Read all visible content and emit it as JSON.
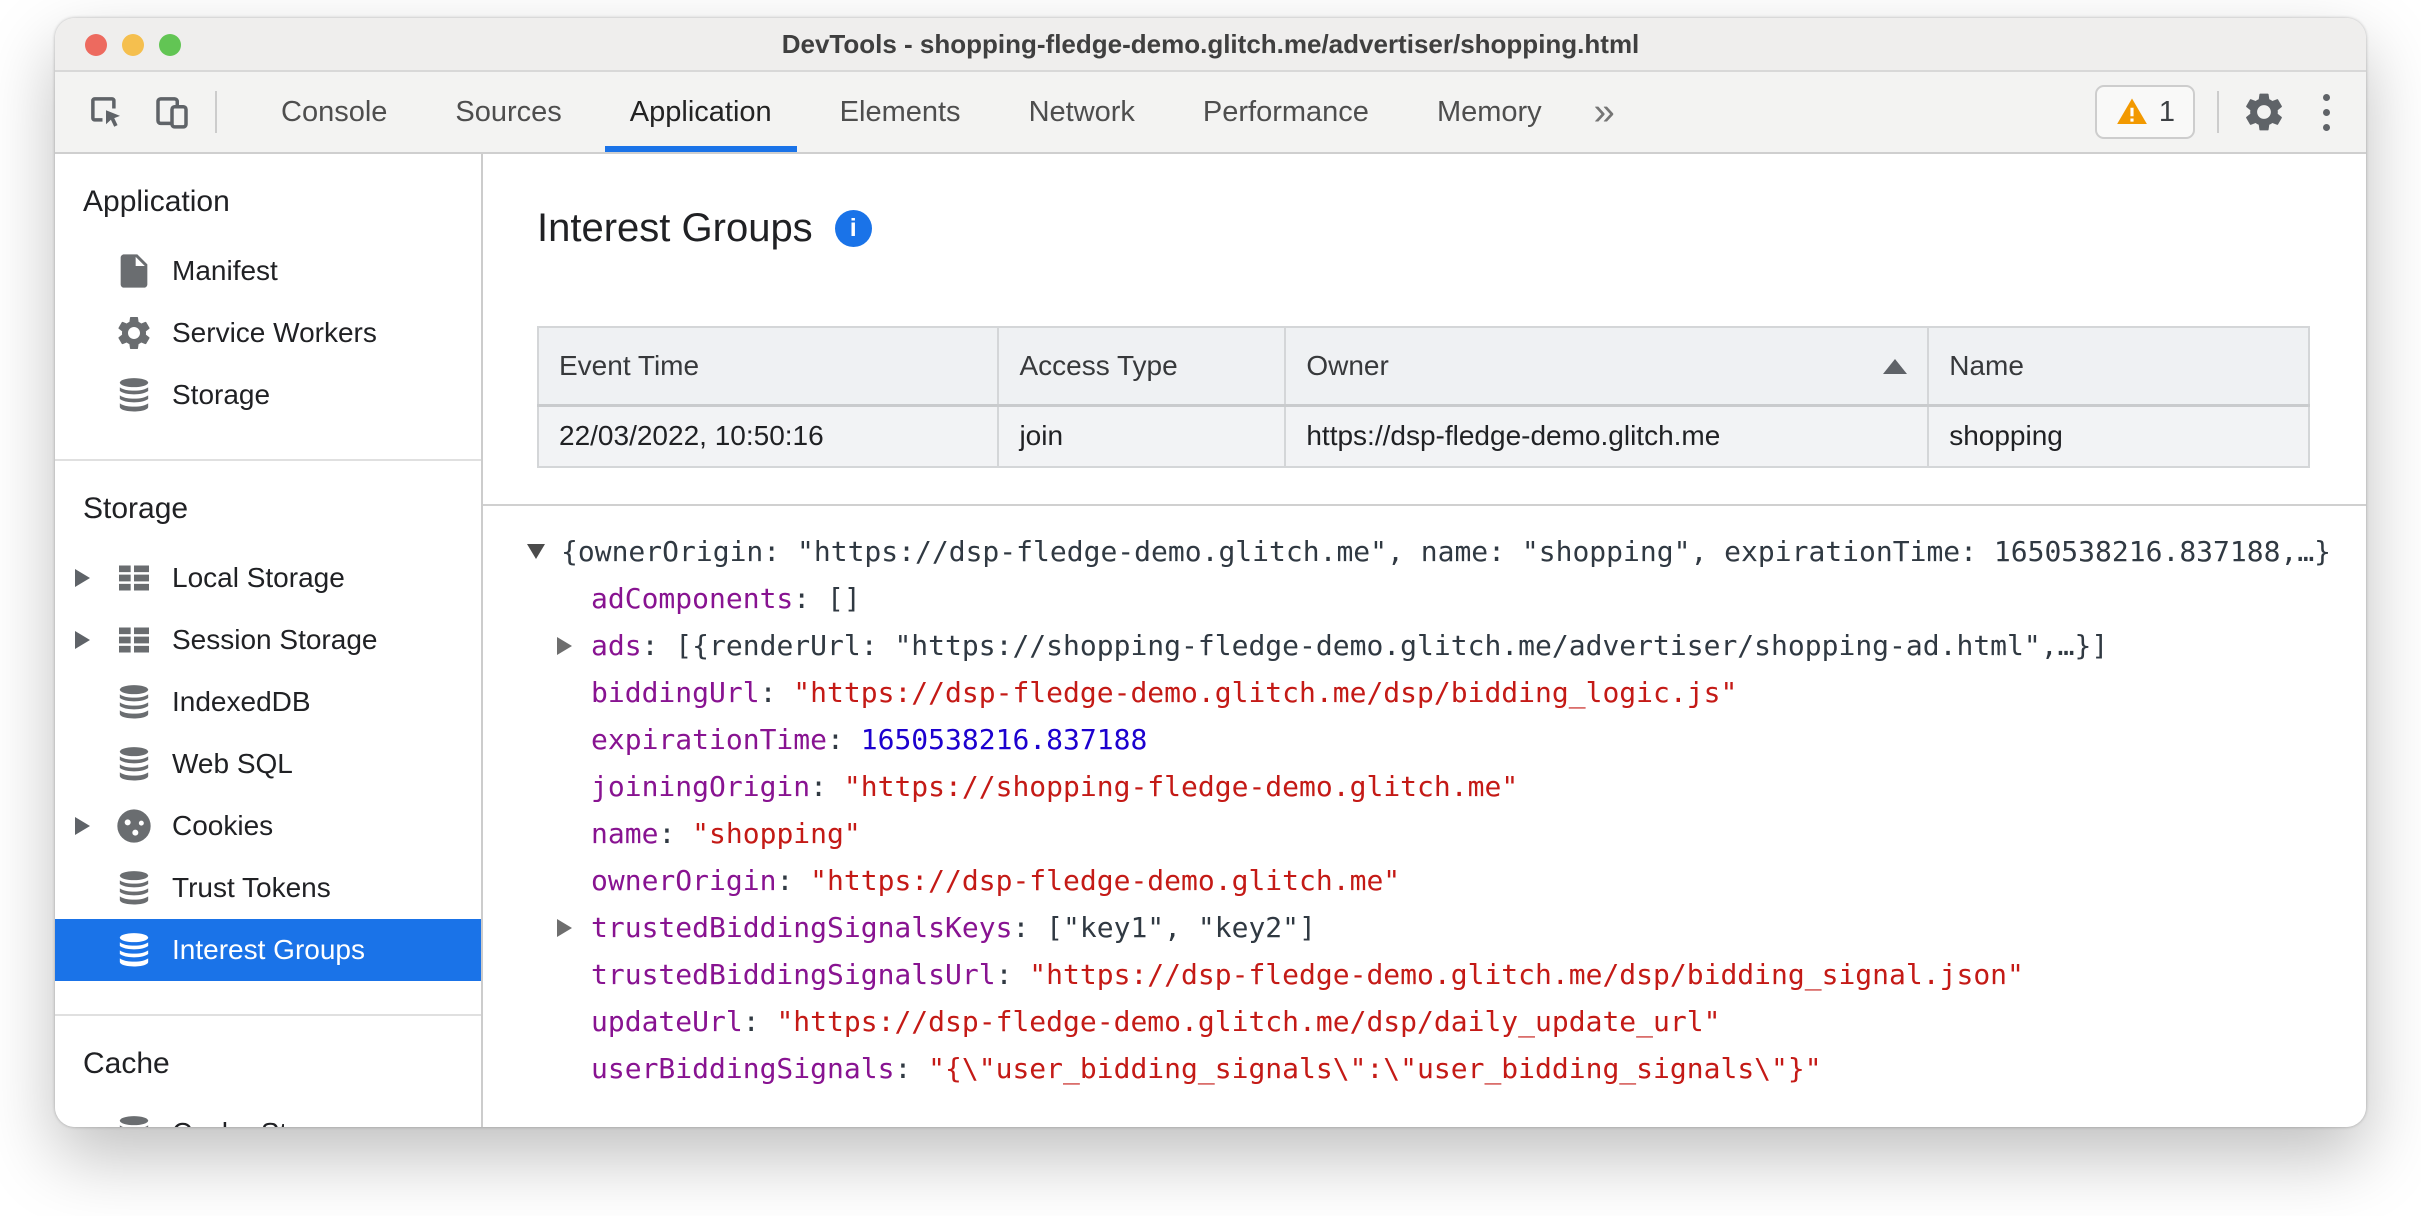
{
  "window": {
    "title": "DevTools - shopping-fledge-demo.glitch.me/advertiser/shopping.html"
  },
  "colors": {
    "accent_blue": "#1a73e8",
    "selection_blue": "#1a73e8",
    "key_purple": "#881391",
    "string_red": "#c41a16",
    "number_blue": "#1c00cf",
    "warning_orange": "#f29900",
    "traffic_red": "#ed6a5f",
    "traffic_yellow": "#f5bf4e",
    "traffic_green": "#62c554"
  },
  "toolbar": {
    "tabs": [
      "Console",
      "Sources",
      "Application",
      "Elements",
      "Network",
      "Performance",
      "Memory"
    ],
    "active_tab": "Application",
    "more_tabs_glyph": "»",
    "warning_count": "1"
  },
  "sidebar": {
    "sections": [
      {
        "title": "Application",
        "items": [
          {
            "label": "Manifest",
            "icon": "document-icon",
            "caret": false,
            "selected": false
          },
          {
            "label": "Service Workers",
            "icon": "gear-icon",
            "caret": false,
            "selected": false
          },
          {
            "label": "Storage",
            "icon": "database-icon",
            "caret": false,
            "selected": false
          }
        ]
      },
      {
        "title": "Storage",
        "items": [
          {
            "label": "Local Storage",
            "icon": "table-icon",
            "caret": true,
            "selected": false
          },
          {
            "label": "Session Storage",
            "icon": "table-icon",
            "caret": true,
            "selected": false
          },
          {
            "label": "IndexedDB",
            "icon": "database-icon",
            "caret": false,
            "selected": false
          },
          {
            "label": "Web SQL",
            "icon": "database-icon",
            "caret": false,
            "selected": false
          },
          {
            "label": "Cookies",
            "icon": "cookie-icon",
            "caret": true,
            "selected": false
          },
          {
            "label": "Trust Tokens",
            "icon": "database-icon",
            "caret": false,
            "selected": false
          },
          {
            "label": "Interest Groups",
            "icon": "database-icon",
            "caret": false,
            "selected": true
          }
        ]
      },
      {
        "title": "Cache",
        "items": [
          {
            "label": "Cache Storage",
            "icon": "database-icon",
            "caret": false,
            "selected": false
          }
        ]
      }
    ]
  },
  "main": {
    "title": "Interest Groups",
    "info_glyph": "i",
    "table": {
      "columns": [
        "Event Time",
        "Access Type",
        "Owner",
        "Name"
      ],
      "sorted_column": "Owner",
      "sort_direction": "asc",
      "rows": [
        [
          "22/03/2022, 10:50:16",
          "join",
          "https://dsp-fledge-demo.glitch.me",
          "shopping"
        ]
      ]
    },
    "tree": {
      "rows": [
        {
          "caret": "down",
          "level": 0,
          "segments": [
            {
              "c": "plain",
              "t": "{ownerOrigin: \"https://dsp-fledge-demo.glitch.me\", name: \"shopping\", expirationTime: 1650538216.837188,…}"
            }
          ]
        },
        {
          "caret": "none",
          "level": 1,
          "segments": [
            {
              "c": "key",
              "t": "adComponents"
            },
            {
              "c": "plain",
              "t": ": []"
            }
          ]
        },
        {
          "caret": "right",
          "level": 1,
          "segments": [
            {
              "c": "key",
              "t": "ads"
            },
            {
              "c": "plain",
              "t": ": [{renderUrl: \"https://shopping-fledge-demo.glitch.me/advertiser/shopping-ad.html\",…}]"
            }
          ]
        },
        {
          "caret": "none",
          "level": 1,
          "segments": [
            {
              "c": "key",
              "t": "biddingUrl"
            },
            {
              "c": "plain",
              "t": ": "
            },
            {
              "c": "string",
              "t": "\"https://dsp-fledge-demo.glitch.me/dsp/bidding_logic.js\""
            }
          ]
        },
        {
          "caret": "none",
          "level": 1,
          "segments": [
            {
              "c": "key",
              "t": "expirationTime"
            },
            {
              "c": "plain",
              "t": ": "
            },
            {
              "c": "number",
              "t": "1650538216.837188"
            }
          ]
        },
        {
          "caret": "none",
          "level": 1,
          "segments": [
            {
              "c": "key",
              "t": "joiningOrigin"
            },
            {
              "c": "plain",
              "t": ": "
            },
            {
              "c": "string",
              "t": "\"https://shopping-fledge-demo.glitch.me\""
            }
          ]
        },
        {
          "caret": "none",
          "level": 1,
          "segments": [
            {
              "c": "key",
              "t": "name"
            },
            {
              "c": "plain",
              "t": ": "
            },
            {
              "c": "string",
              "t": "\"shopping\""
            }
          ]
        },
        {
          "caret": "none",
          "level": 1,
          "segments": [
            {
              "c": "key",
              "t": "ownerOrigin"
            },
            {
              "c": "plain",
              "t": ": "
            },
            {
              "c": "string",
              "t": "\"https://dsp-fledge-demo.glitch.me\""
            }
          ]
        },
        {
          "caret": "right",
          "level": 1,
          "segments": [
            {
              "c": "key",
              "t": "trustedBiddingSignalsKeys"
            },
            {
              "c": "plain",
              "t": ": [\"key1\", \"key2\"]"
            }
          ]
        },
        {
          "caret": "none",
          "level": 1,
          "segments": [
            {
              "c": "key",
              "t": "trustedBiddingSignalsUrl"
            },
            {
              "c": "plain",
              "t": ": "
            },
            {
              "c": "string",
              "t": "\"https://dsp-fledge-demo.glitch.me/dsp/bidding_signal.json\""
            }
          ]
        },
        {
          "caret": "none",
          "level": 1,
          "segments": [
            {
              "c": "key",
              "t": "updateUrl"
            },
            {
              "c": "plain",
              "t": ": "
            },
            {
              "c": "string",
              "t": "\"https://dsp-fledge-demo.glitch.me/dsp/daily_update_url\""
            }
          ]
        },
        {
          "caret": "none",
          "level": 1,
          "segments": [
            {
              "c": "key",
              "t": "userBiddingSignals"
            },
            {
              "c": "plain",
              "t": ": "
            },
            {
              "c": "string",
              "t": "\"{\\\"user_bidding_signals\\\":\\\"user_bidding_signals\\\"}\""
            }
          ]
        }
      ]
    }
  }
}
